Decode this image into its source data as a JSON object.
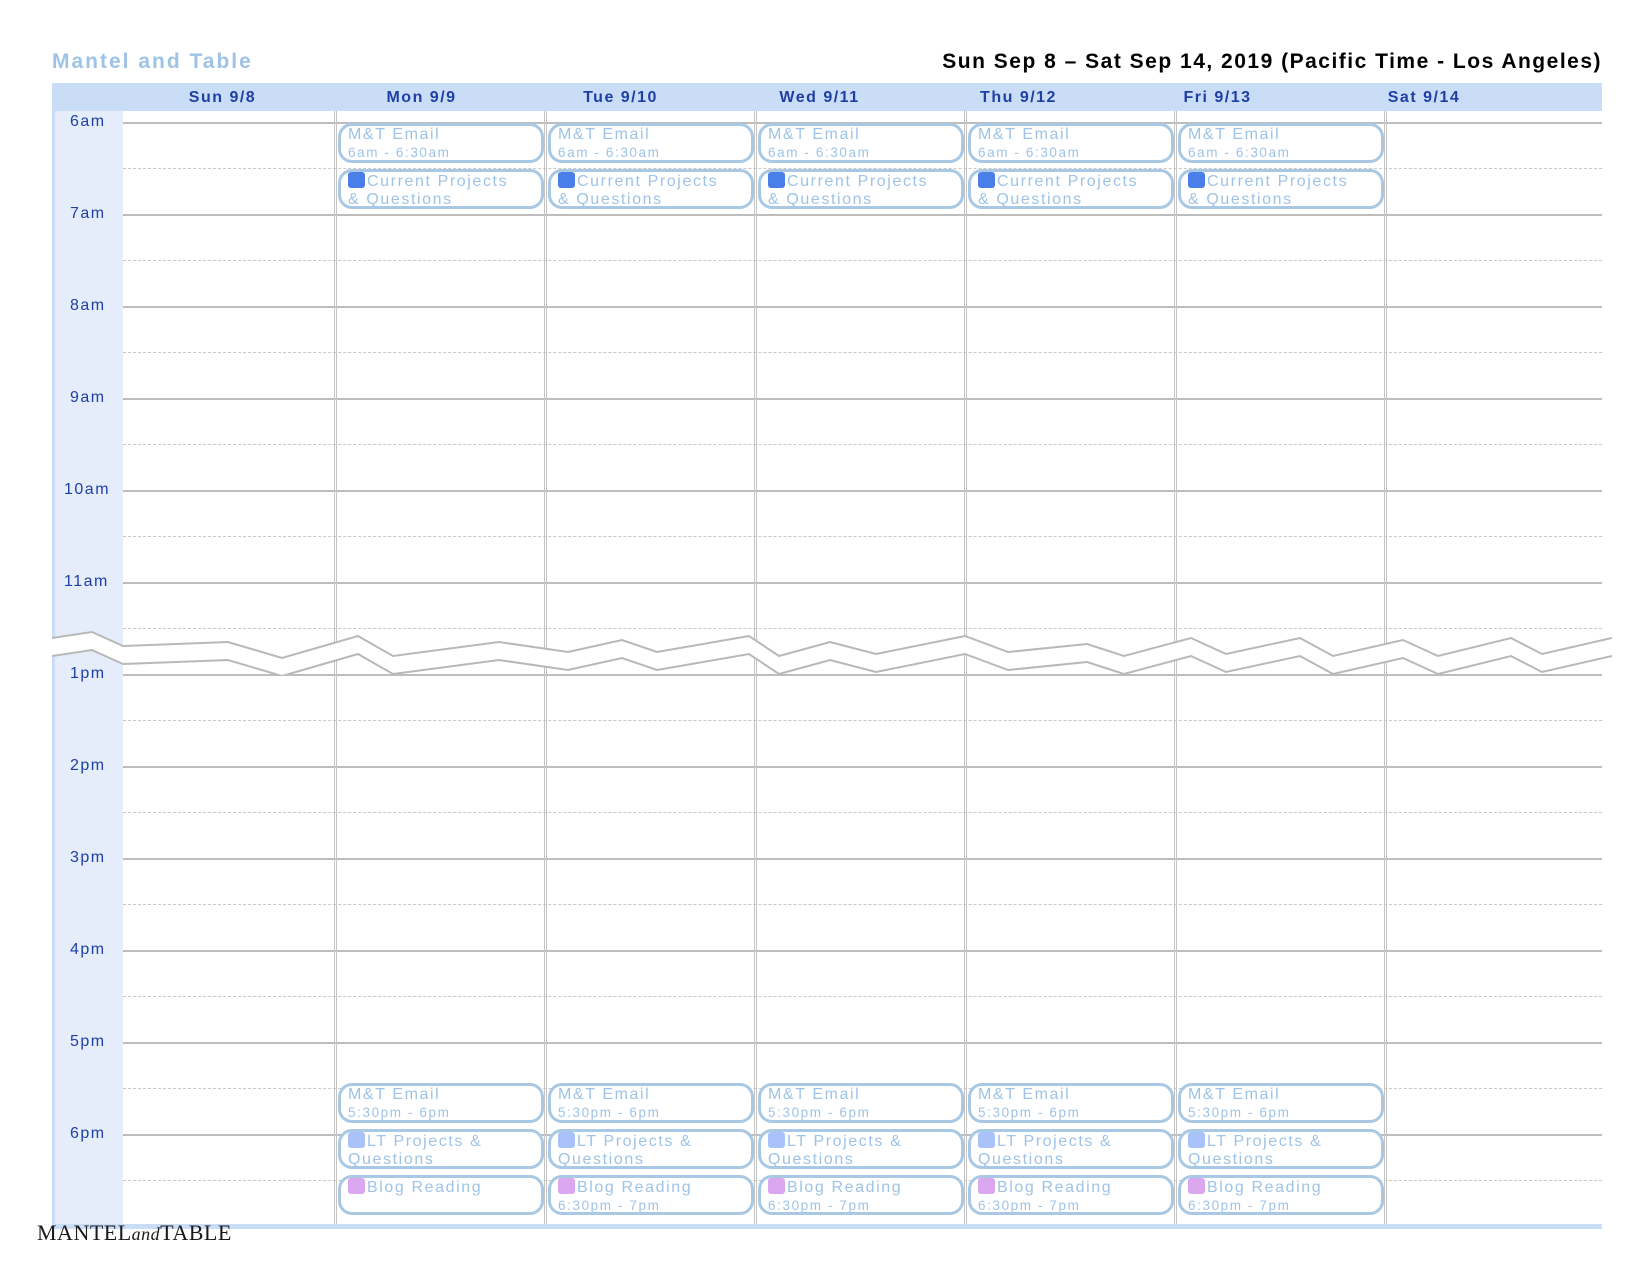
{
  "calendar_title": "Mantel and Table",
  "date_range": "Sun Sep 8 – Sat Sep 14, 2019 (Pacific Time - Los Angeles)",
  "days": [
    "Sun 9/8",
    "Mon 9/9",
    "Tue 9/10",
    "Wed 9/11",
    "Thu 9/12",
    "Fri 9/13",
    "Sat 9/14"
  ],
  "times": [
    "6am",
    "7am",
    "8am",
    "9am",
    "10am",
    "11am",
    "1pm",
    "2pm",
    "3pm",
    "4pm",
    "5pm",
    "6pm"
  ],
  "colors": {
    "dark_blue": "#4a7ee8",
    "light_blue": "#a9c2fa",
    "pink": "#dba7ef",
    "border": "#a8c8e4",
    "text": "#9ec3e6"
  },
  "events": {
    "mt_email_am": {
      "title": "M&T Email",
      "time": "6am - 6:30am"
    },
    "current_projects": {
      "title_1": "Current Projects",
      "title_2": "& Questions",
      "color": "dark_blue"
    },
    "mt_email_pm": {
      "title": "M&T Email",
      "time": "5:30pm - 6pm"
    },
    "lt_projects": {
      "title_1": "LT Projects &",
      "title_2": "Questions",
      "color": "light_blue"
    },
    "blog_reading": {
      "title": "Blog Reading",
      "time": "6:30pm - 7pm",
      "color": "pink"
    }
  },
  "logo": {
    "left": "MANTEL",
    "mid": "and",
    "right": "TABLE"
  }
}
